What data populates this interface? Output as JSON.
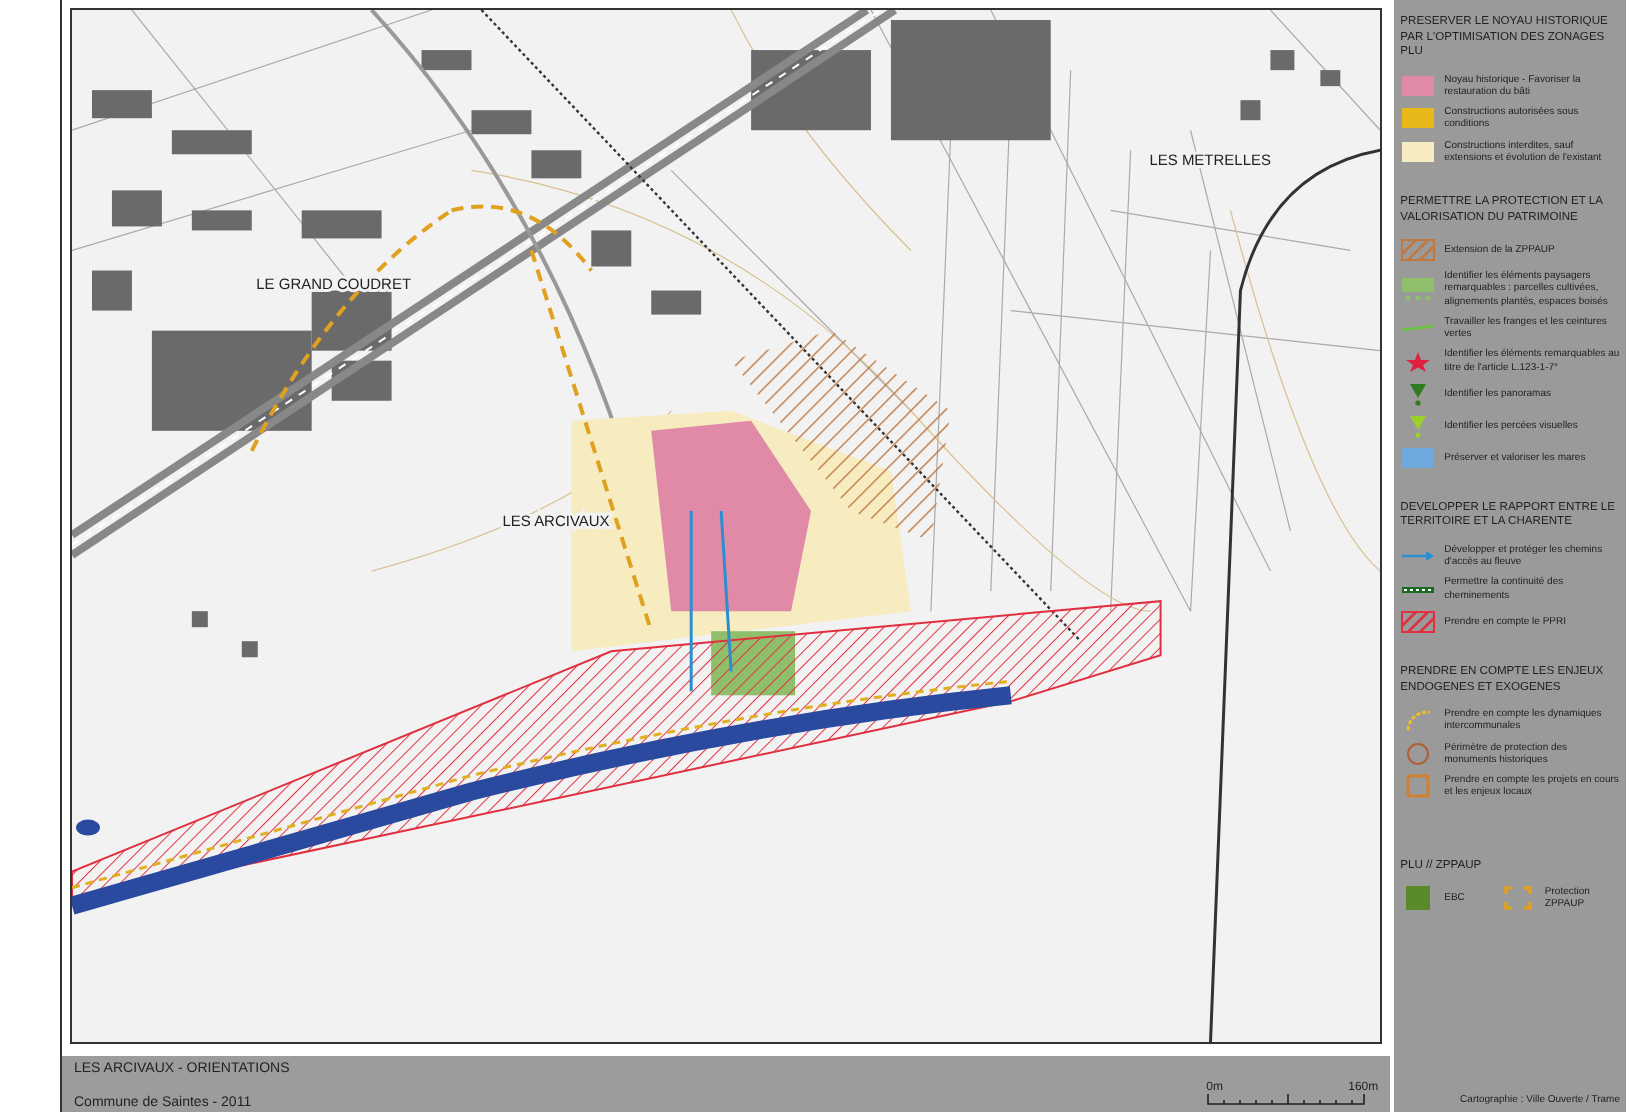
{
  "map": {
    "places": [
      {
        "name": "LE GRAND COUDRET"
      },
      {
        "name": "LES ARCIVAUX"
      },
      {
        "name": "LES METRELLES"
      }
    ]
  },
  "legend": {
    "sections": [
      {
        "title": "PRESERVER LE NOYAU HISTORIQUE PAR L'OPTIMISATION DES ZONAGES PLU",
        "items": [
          {
            "kind": "swatch",
            "color": "#e08aa8",
            "label": "Noyau historique - Favoriser la restauration du bâti"
          },
          {
            "kind": "swatch",
            "color": "#e8b818",
            "label": "Constructions autorisées sous conditions"
          },
          {
            "kind": "swatch",
            "color": "#f6ecc0",
            "label": "Constructions interdites, sauf extensions et évolution de l'existant"
          }
        ]
      },
      {
        "title": "PERMETTRE LA PROTECTION ET LA VALORISATION DU PATRIMOINE",
        "items": [
          {
            "kind": "hatch",
            "color": "#c07840",
            "label": "Extension de la ZPPAUP"
          },
          {
            "kind": "greenery",
            "color": "#8fbf6a",
            "label": "Identifier les éléments paysagers remarquables : parcelles cultivées, alignements plantés, espaces boisés"
          },
          {
            "kind": "line",
            "color": "#6cc04a",
            "label": "Travailler les franges et les ceintures vertes"
          },
          {
            "kind": "star",
            "color": "#e02040",
            "label": "Identifier les éléments remarquables au titre de l'article L.123-1-7°"
          },
          {
            "kind": "panorama",
            "color": "#2f7d20",
            "label": "Identifier les panoramas"
          },
          {
            "kind": "panorama",
            "color": "#9ad02a",
            "label": "Identifier les percées visuelles"
          },
          {
            "kind": "swatch",
            "color": "#6fa8dc",
            "label": "Préserver et valoriser les mares"
          }
        ]
      },
      {
        "title": "DEVELOPPER LE RAPPORT ENTRE LE TERRITOIRE ET LA CHARENTE",
        "items": [
          {
            "kind": "arrow",
            "color": "#2a8fd0",
            "label": "Développer et protéger les chemins d'accès au fleuve"
          },
          {
            "kind": "dots",
            "color": "#1a6a20",
            "label": "Permettre la continuité des cheminements"
          },
          {
            "kind": "hatch",
            "color": "#e03040",
            "label": "Prendre en compte le PPRI"
          }
        ]
      },
      {
        "title": "PRENDRE EN COMPTE LES ENJEUX ENDOGENES ET EXOGENES",
        "items": [
          {
            "kind": "arc",
            "color": "#f0c020",
            "label": "Prendre en compte les dynamiques intercommunales"
          },
          {
            "kind": "circle",
            "color": "#b06030",
            "label": "Périmètre de protection des monuments historiques"
          },
          {
            "kind": "square",
            "color": "#d08030",
            "label": "Prendre en compte les projets en cours et les enjeux locaux"
          }
        ]
      }
    ],
    "plu": {
      "title": "PLU // ZPPAUP",
      "items": [
        {
          "kind": "swatch",
          "color": "#5a8a2a",
          "label": "EBC"
        },
        {
          "kind": "corners",
          "color": "#e0a020",
          "label": "Protection ZPPAUP"
        }
      ]
    },
    "credit": "Cartographie : Ville Ouverte / Trame"
  },
  "footer": {
    "title": "LES ARCIVAUX - ORIENTATIONS",
    "subtitle": "Commune de Saintes - 2011",
    "scale_start": "0m",
    "scale_end": "160m"
  }
}
